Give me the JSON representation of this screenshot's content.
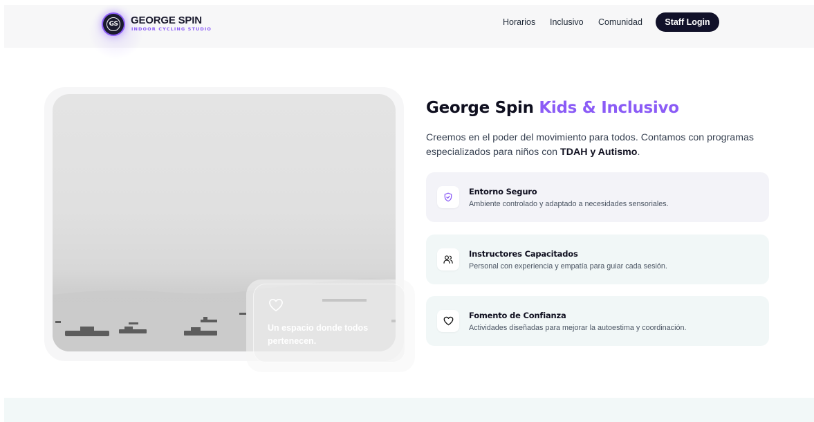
{
  "brand": {
    "logo_monogram": "GS",
    "name": "GEORGE SPIN",
    "tagline": "INDOOR CYCLING STUDIO",
    "accent_color": "#8b5cf6"
  },
  "nav": {
    "links": [
      "Horarios",
      "Inclusivo",
      "Comunidad"
    ],
    "staff_login": "Staff Login"
  },
  "hero_image": {
    "overlay_icon": "heart-icon",
    "overlay_text": "Un espacio donde todos pertenecen."
  },
  "section": {
    "title_main": "George Spin ",
    "title_accent": "Kids & Inclusivo",
    "lead_prefix": "Creemos en el poder del movimiento para todos. Contamos con programas especializados para niños con ",
    "lead_bold": "TDAH y Autismo",
    "lead_suffix": "."
  },
  "features": [
    {
      "icon": "shield-check-icon",
      "title": "Entorno Seguro",
      "description": "Ambiente controlado y adaptado a necesidades sensoriales."
    },
    {
      "icon": "users-icon",
      "title": "Instructores Capacitados",
      "description": "Personal con experiencia y empatía para guiar cada sesión."
    },
    {
      "icon": "heart-icon",
      "title": "Fomento de Confianza",
      "description": "Actividades diseñadas para mejorar la autoestima y coordinación."
    }
  ]
}
